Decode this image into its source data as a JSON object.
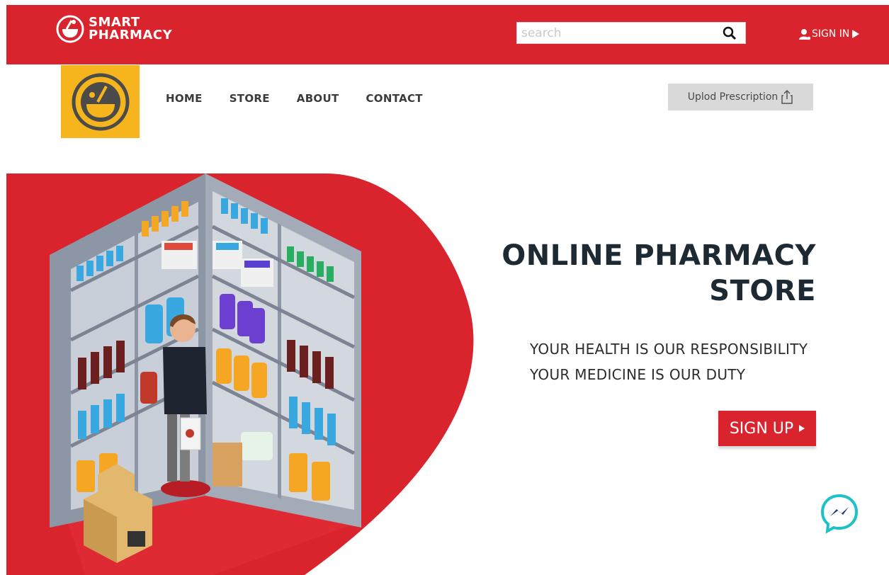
{
  "header": {
    "brand_line1": "SMART",
    "brand_line2": "PHARMACY",
    "search": {
      "placeholder": "search",
      "value": ""
    },
    "signin_label": "SIGN IN",
    "bar_color": "#d9232d"
  },
  "nav": {
    "items": [
      {
        "label": "HOME"
      },
      {
        "label": "STORE"
      },
      {
        "label": "ABOUT"
      },
      {
        "label": "CONTACT"
      }
    ],
    "upload_label": "Uplod Prescription"
  },
  "hero": {
    "title_line1": "ONLINE PHARMACY",
    "title_line2": "STORE",
    "tagline_line1": "YOUR HEALTH IS OUR RESPONSIBILITY",
    "tagline_line2": "YOUR MEDICINE IS OUR DUTY",
    "signup_label": "SIGN UP"
  },
  "colors": {
    "accent_red": "#d9232d",
    "logo_yellow": "#f7b51d",
    "upload_gray": "#d9d9d9",
    "messenger_teal": "#1fc0c8"
  },
  "icons": [
    "pharmacy-logo-icon",
    "search-icon",
    "user-icon",
    "play-arrow-icon",
    "upload-icon",
    "messenger-icon"
  ]
}
